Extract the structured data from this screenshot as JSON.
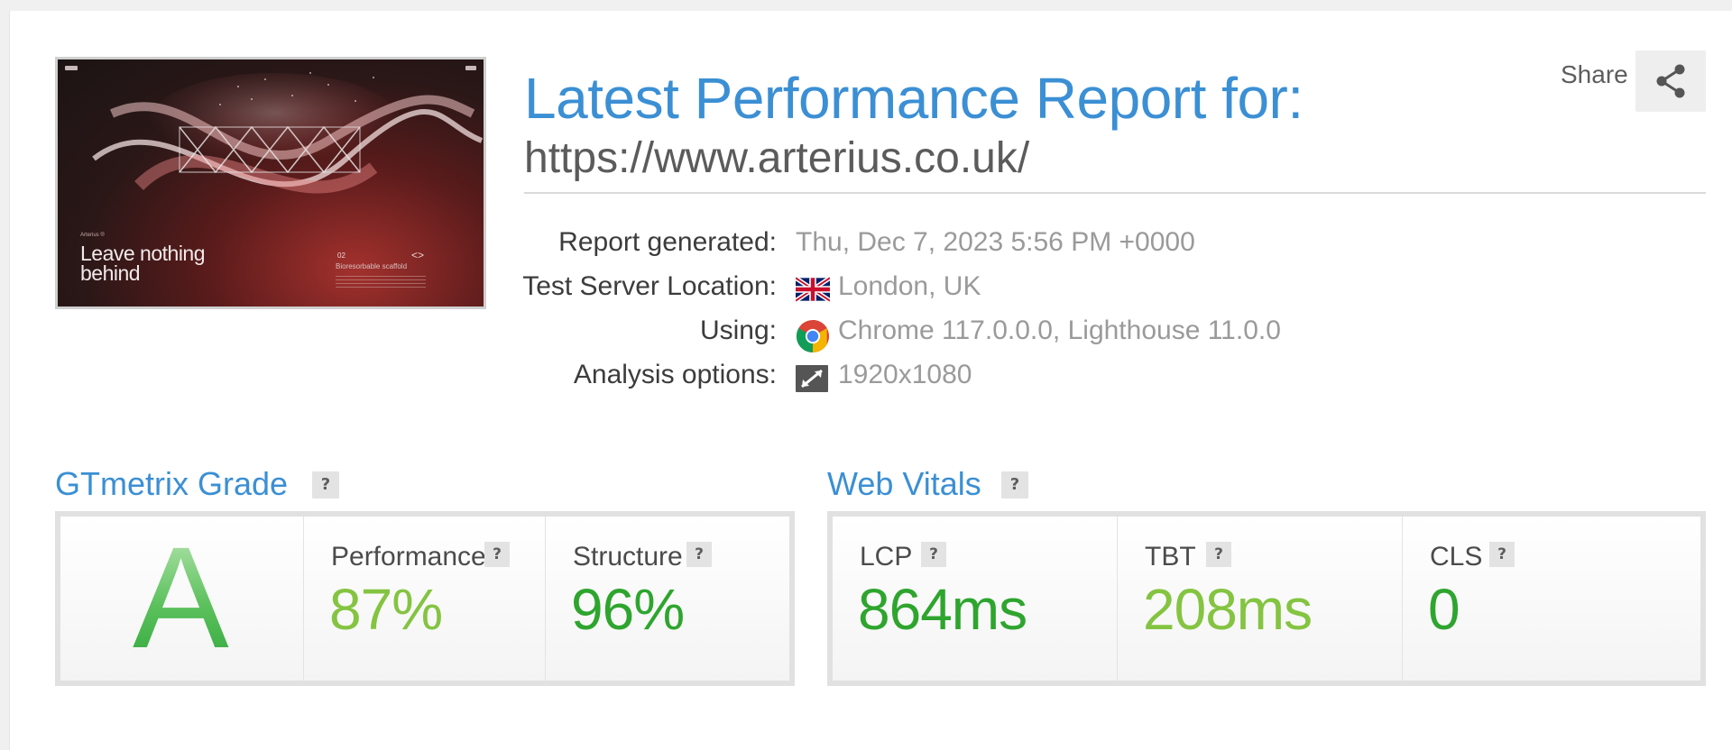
{
  "thumbnail": {
    "headline": "Leave nothing behind",
    "kicker": "Arterius ®",
    "number": "02",
    "nav": "<>",
    "caption": "Bioresorbable scaffold"
  },
  "header": {
    "title": "Latest Performance Report for:",
    "url": "https://www.arterius.co.uk/",
    "share_label": "Share"
  },
  "info": {
    "report_generated_label": "Report generated:",
    "report_generated_value": "Thu, Dec 7, 2023 5:56 PM +0000",
    "location_label": "Test Server Location:",
    "location_value": "London, UK",
    "using_label": "Using:",
    "using_value": "Chrome 117.0.0.0, Lighthouse 11.0.0",
    "options_label": "Analysis options:",
    "options_value": "1920x1080"
  },
  "grade": {
    "title": "GTmetrix Grade",
    "help": "?",
    "letter": "A",
    "performance_label": "Performance",
    "performance_value": "87%",
    "structure_label": "Structure",
    "structure_value": "96%"
  },
  "vitals": {
    "title": "Web Vitals",
    "help": "?",
    "lcp_label": "LCP",
    "lcp_value": "864ms",
    "tbt_label": "TBT",
    "tbt_value": "208ms",
    "cls_label": "CLS",
    "cls_value": "0"
  },
  "colors": {
    "accent": "#3b8fd4",
    "good_dark": "#2ea52e",
    "good_light": "#84c441"
  }
}
